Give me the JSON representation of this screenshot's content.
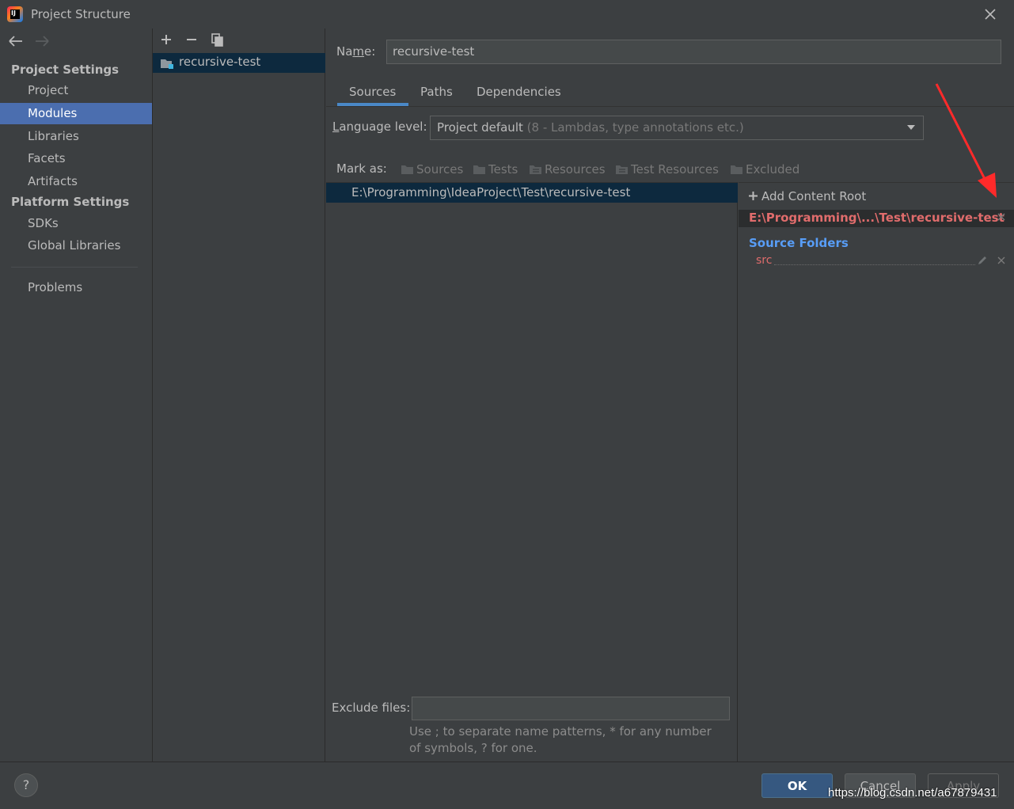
{
  "window": {
    "title": "Project Structure"
  },
  "nav": {
    "project_settings_header": "Project Settings",
    "project_items": [
      "Project",
      "Modules",
      "Libraries",
      "Facets",
      "Artifacts"
    ],
    "platform_settings_header": "Platform Settings",
    "platform_items": [
      "SDKs",
      "Global Libraries"
    ],
    "problems": "Problems",
    "selected": "Modules"
  },
  "modules": {
    "items": [
      "recursive-test"
    ]
  },
  "main": {
    "name_label": "Name:",
    "name_value": "recursive-test",
    "tabs": [
      "Sources",
      "Paths",
      "Dependencies"
    ],
    "active_tab": "Sources",
    "language_label": "Language level:",
    "language_value": "Project default",
    "language_hint": "(8 - Lambdas, type annotations etc.)",
    "mark_as_label": "Mark as:",
    "mark_buttons": [
      "Sources",
      "Tests",
      "Resources",
      "Test Resources",
      "Excluded"
    ],
    "tree_root": "E:\\Programming\\IdeaProject\\Test\\recursive-test",
    "add_content_root": "Add Content Root",
    "content_root_path": "E:\\Programming\\...\\Test\\recursive-test",
    "source_folders_header": "Source Folders",
    "source_folder": "src",
    "exclude_label": "Exclude files:",
    "exclude_value": "",
    "exclude_hint": "Use ; to separate name patterns, * for any number of symbols, ? for one."
  },
  "buttons": {
    "ok": "OK",
    "cancel": "Cancel",
    "apply": "Apply",
    "help": "?"
  },
  "watermark": "https://blog.csdn.net/a67879431",
  "colors": {
    "selection": "#4b6eaf",
    "accent_red": "#e06c6c",
    "source_blue": "#589df6",
    "annotation_arrow": "#ff2a2a"
  }
}
